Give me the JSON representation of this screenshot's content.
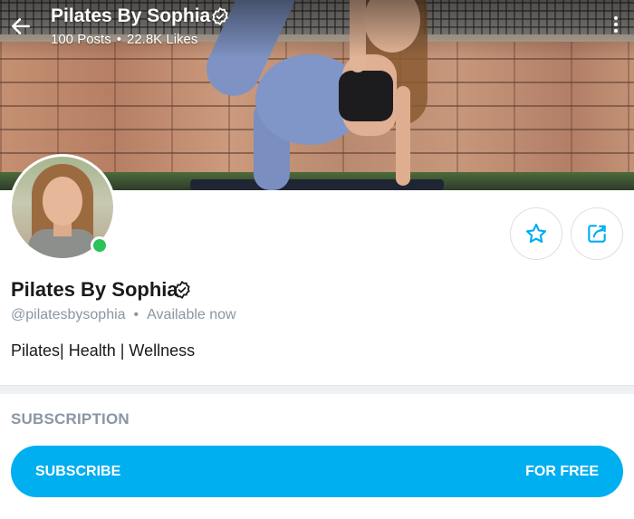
{
  "header": {
    "title": "Pilates By Sophia",
    "posts": "100 Posts",
    "separator": "•",
    "likes": "22.8K Likes"
  },
  "icons": {
    "back": "arrow-left-icon",
    "verified": "verified-badge-icon",
    "more": "more-vertical-icon",
    "favorite": "star-icon",
    "share": "share-icon"
  },
  "profile": {
    "name": "Pilates By Sophia",
    "handle": "@pilatesbysophia",
    "separator": "•",
    "status": "Available now",
    "bio": "Pilates| Health | Wellness",
    "online": true
  },
  "subscription": {
    "section_title": "SUBSCRIPTION",
    "button_label": "SUBSCRIBE",
    "price_label": "FOR FREE"
  },
  "colors": {
    "accent": "#00aff0",
    "online": "#2bc25a",
    "muted_text": "#8a96a3"
  }
}
